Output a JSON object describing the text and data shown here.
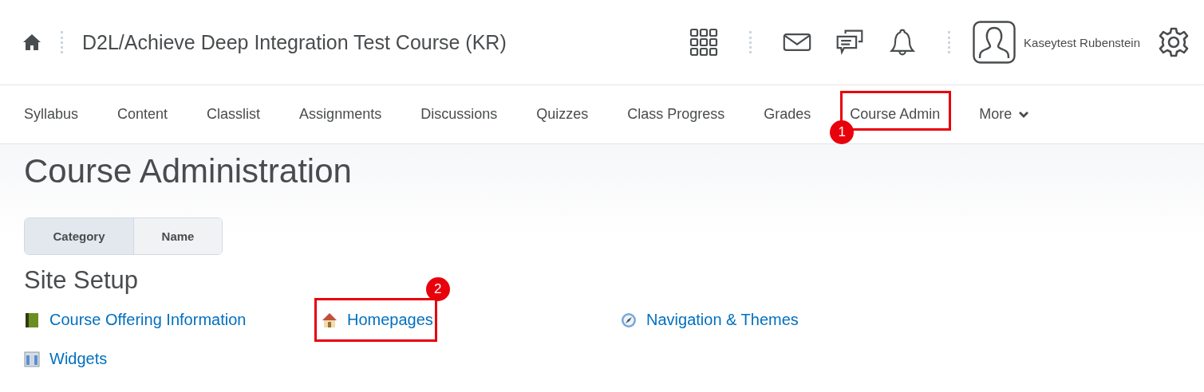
{
  "header": {
    "course_title": "D2L/Achieve Deep Integration Test Course (KR)",
    "user_name": "Kaseytest Rubenstein"
  },
  "nav": [
    {
      "label": "Syllabus",
      "selected": false
    },
    {
      "label": "Content",
      "selected": false
    },
    {
      "label": "Classlist",
      "selected": false
    },
    {
      "label": "Assignments",
      "selected": false
    },
    {
      "label": "Discussions",
      "selected": false
    },
    {
      "label": "Quizzes",
      "selected": false
    },
    {
      "label": "Class Progress",
      "selected": false
    },
    {
      "label": "Grades",
      "selected": false
    },
    {
      "label": "Course Admin",
      "selected": false,
      "callout": {
        "number": "1"
      }
    },
    {
      "label": "More",
      "selected": false,
      "kind": "menu"
    }
  ],
  "page_title": "Course Administration",
  "view_toggle": [
    {
      "label": "Category",
      "selected": true
    },
    {
      "label": "Name",
      "selected": false
    }
  ],
  "section": {
    "title": "Site Setup",
    "links": [
      {
        "label": "Course Offering Information",
        "kind": "book"
      },
      {
        "label": "Homepages",
        "kind": "house",
        "callout": {
          "number": "2"
        }
      },
      {
        "label": "Navigation & Themes",
        "kind": "compass"
      },
      {
        "label": "Widgets",
        "kind": "widgets"
      }
    ]
  }
}
